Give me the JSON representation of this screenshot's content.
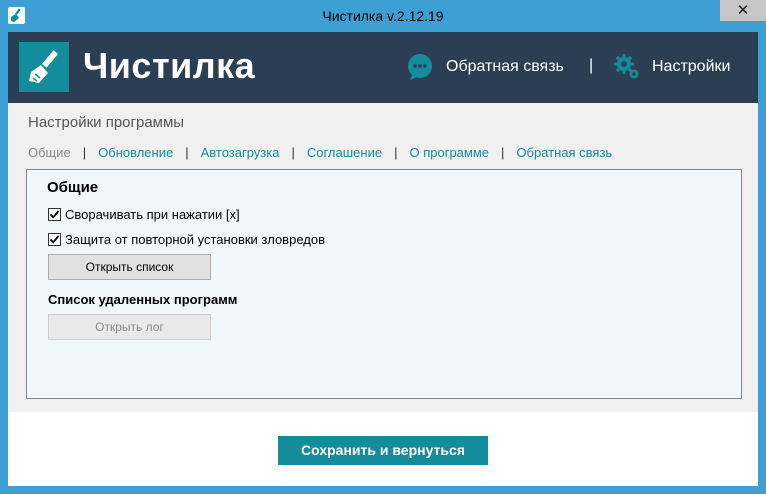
{
  "window": {
    "title": "Чистилка v.2.12.19",
    "close_glyph": "✕"
  },
  "header": {
    "brand": "Чистилка",
    "feedback_label": "Обратная связь",
    "separator": "|",
    "settings_label": "Настройки"
  },
  "page": {
    "section_title": "Настройки программы"
  },
  "tabs": [
    {
      "label": "Общие",
      "active": true
    },
    {
      "label": "Обновление",
      "active": false
    },
    {
      "label": "Автозагрузка",
      "active": false
    },
    {
      "label": "Соглашение",
      "active": false
    },
    {
      "label": "О программе",
      "active": false
    },
    {
      "label": "Обратная связь",
      "active": false
    }
  ],
  "tab_separator": "|",
  "panel": {
    "heading": "Общие",
    "options": [
      {
        "label": "Сворачивать при нажатии [x]",
        "checked": true
      },
      {
        "label": "Защита от повторной установки зловредов",
        "checked": true
      }
    ],
    "open_list_button": "Открыть список",
    "removed_programs_heading": "Список удаленных программ",
    "open_log_button": "Открыть лог"
  },
  "footer": {
    "save_button": "Сохранить и вернуться"
  },
  "icons": {
    "app": "broom-icon",
    "logo": "broom-icon",
    "feedback": "chat-bubble-icon",
    "settings": "gear-icon",
    "checkbox": "checkmark-icon"
  },
  "colors": {
    "accent": "#138d9b",
    "header_bg": "#2c3e53",
    "window_frame": "#3e9fd5",
    "panel_bg": "#f0f7f9"
  }
}
